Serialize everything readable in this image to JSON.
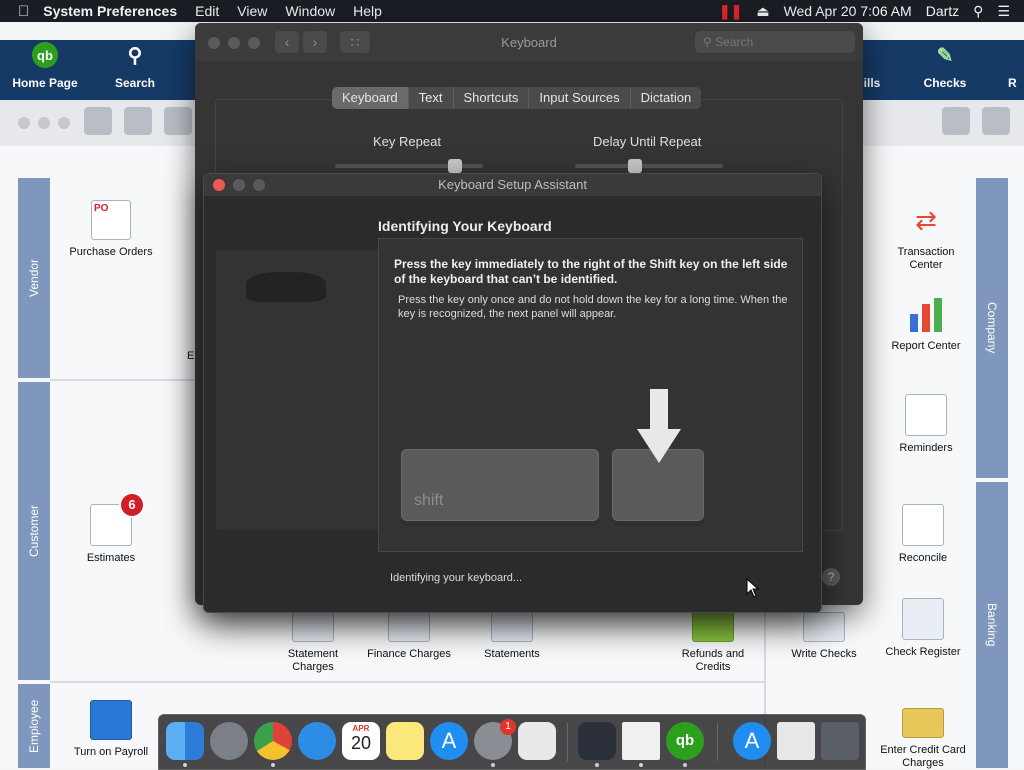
{
  "menubar": {
    "apple": "",
    "app": "System Preferences",
    "items": [
      "Edit",
      "View",
      "Window",
      "Help"
    ],
    "datetime": "Wed Apr 20  7:06 AM",
    "user": "Dartz"
  },
  "quickbooks": {
    "toolbar": {
      "home": "Home Page",
      "search": "Search",
      "bills": "Bills",
      "checks": "Checks",
      "more": "R"
    },
    "bands": {
      "vendor": "Vendor",
      "customer": "Customer",
      "employee": "Employee",
      "company": "Company",
      "banking": "Banking"
    },
    "nodes": {
      "purchase_orders": "Purchase Orders",
      "estimates": "Estimates",
      "estimates_badge": "6",
      "statement_charges": "Statement Charges",
      "finance_charges": "Finance Charges",
      "statements": "Statements",
      "refunds_credits": "Refunds and Credits",
      "write_checks": "Write Checks",
      "check_register": "Check Register",
      "turn_on_payroll": "Turn on Payroll",
      "enter_cc_charges": "Enter Credit Card Charges",
      "transaction_center": "Transaction Center",
      "report_center": "Report Center",
      "reminders": "Reminders",
      "reconcile": "Reconcile",
      "partial_e": "E"
    }
  },
  "keyboard_window": {
    "title": "Keyboard",
    "search_placeholder": "Search",
    "tabs": [
      "Keyboard",
      "Text",
      "Shortcuts",
      "Input Sources",
      "Dictation"
    ],
    "selected_tab": "Keyboard",
    "key_repeat_label": "Key Repeat",
    "delay_label": "Delay Until Repeat",
    "help": "?"
  },
  "setup_assistant": {
    "title": "Keyboard Setup Assistant",
    "heading": "Identifying Your Keyboard",
    "instruction": "Press the key immediately to the right of the Shift key on the left side of the keyboard that can’t be identified.",
    "sub": "Press the key only once and do not hold down the key for a long time. When the key is recognized, the next panel will appear.",
    "shift_label": "shift",
    "status": "Identifying your keyboard..."
  },
  "dock": {
    "calendar_month": "APR",
    "calendar_day": "20",
    "sysprefs_badge": "1"
  },
  "colors": {
    "qb_toolbar": "#153a66",
    "qb_band": "#7f97bd",
    "accent_red": "#d21f26",
    "dark_window": "#2b2b2b"
  }
}
